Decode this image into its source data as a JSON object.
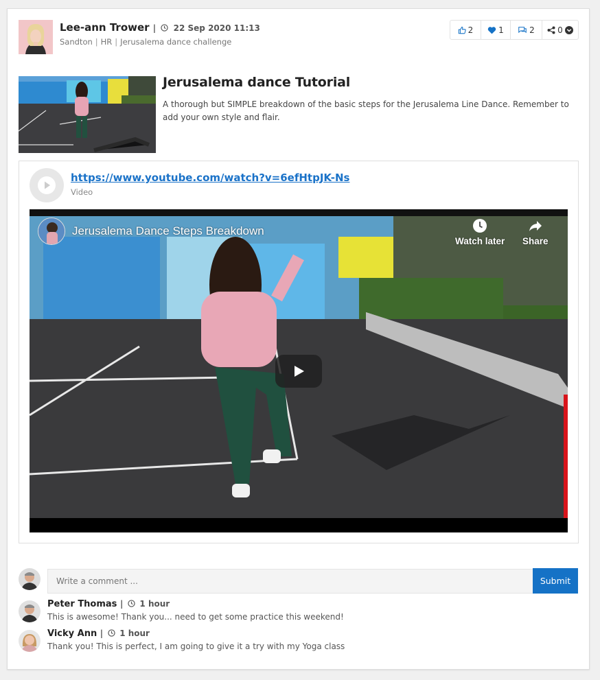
{
  "post": {
    "author": "Lee-ann Trower",
    "date": "22 Sep 2020 11:13",
    "location": "Sandton",
    "department": "HR",
    "group": "Jerusalema dance challenge",
    "title": "Jerusalema dance Tutorial",
    "description": "A thorough but SIMPLE breakdown of the basic steps for the Jerusalema Line Dance. Remember to add your own style and flair."
  },
  "actions": {
    "likes": "2",
    "loves": "1",
    "comments": "2",
    "shares": "0"
  },
  "embed": {
    "url": "https://www.youtube.com/watch?v=6efHtpJK-Ns",
    "type": "Video",
    "video_title": "Jerusalema Dance Steps Breakdown",
    "watch_later": "Watch later",
    "share": "Share"
  },
  "composer": {
    "placeholder": "Write a comment ...",
    "submit_label": "Submit"
  },
  "comments": [
    {
      "name": "Peter Thomas",
      "time": "1 hour",
      "text": "This is awesome! Thank you... need to get some practice this weekend!"
    },
    {
      "name": "Vicky Ann",
      "time": "1 hour",
      "text": "Thank you! This is perfect, I am going to give it a try with my Yoga class"
    }
  ],
  "colors": {
    "accent": "#1572c6",
    "link": "#1a72c8",
    "border": "#dedede"
  },
  "icons": [
    "thumbs-up-icon",
    "heart-icon",
    "comment-icon",
    "share-icon",
    "chevron-down-icon",
    "clock-icon",
    "play-icon"
  ]
}
